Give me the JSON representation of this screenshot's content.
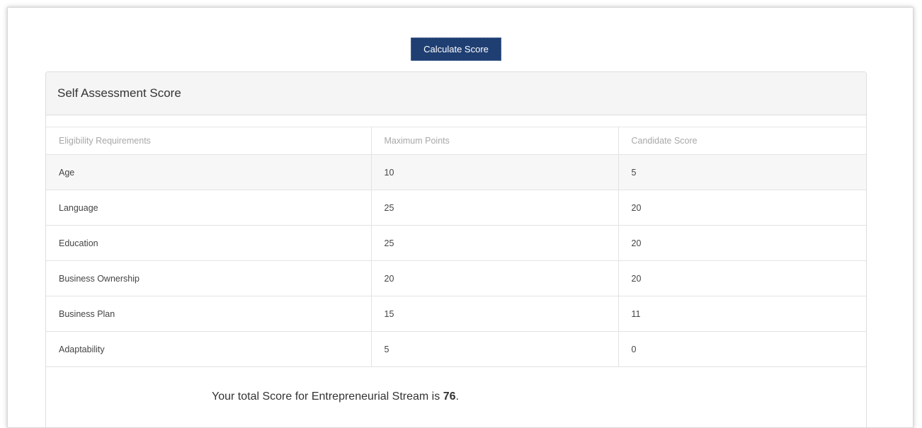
{
  "calculate_button": {
    "label": "Calculate Score",
    "color": "#1f3f73"
  },
  "panel": {
    "title": "Self Assessment Score"
  },
  "table": {
    "headers": [
      "Eligibility Requirements",
      "Maximum Points",
      "Candidate Score"
    ],
    "rows": [
      {
        "requirement": "Age",
        "max": "10",
        "score": "5"
      },
      {
        "requirement": "Language",
        "max": "25",
        "score": "20"
      },
      {
        "requirement": "Education",
        "max": "25",
        "score": "20"
      },
      {
        "requirement": "Business Ownership",
        "max": "20",
        "score": "20"
      },
      {
        "requirement": "Business Plan",
        "max": "15",
        "score": "11"
      },
      {
        "requirement": "Adaptability",
        "max": "5",
        "score": "0"
      }
    ]
  },
  "total": {
    "prefix": "Your total Score for Entrepreneurial Stream is ",
    "value": "76",
    "suffix": "."
  }
}
